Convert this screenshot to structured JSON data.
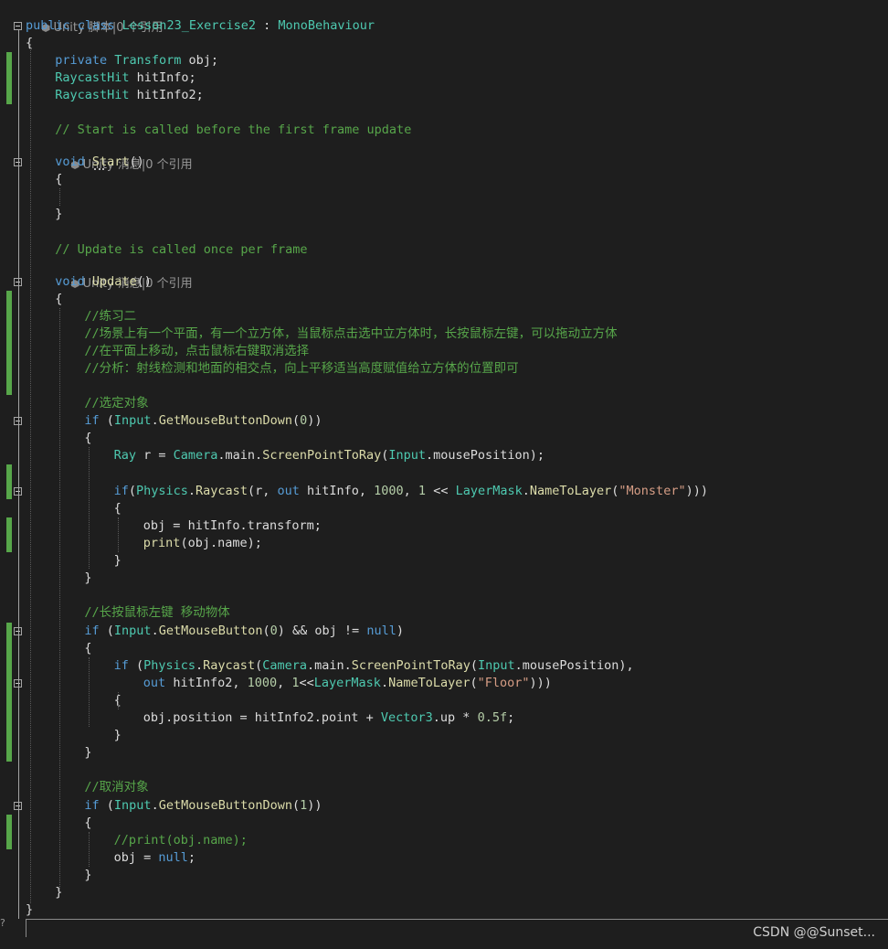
{
  "editor": {
    "codelens": {
      "class_lens": "Unity 脚本|0 个引用",
      "start_lens": "Unity 消息|0 个引用",
      "update_lens": "Unity 消息|0 个引用"
    },
    "lines": [
      [
        [
          "public class ",
          "kw"
        ],
        [
          "Lesson23_Exercise2",
          "ty"
        ],
        [
          " : ",
          "pl"
        ],
        [
          "MonoBehaviour",
          "ty"
        ]
      ],
      [
        [
          "{",
          "pl"
        ]
      ],
      [],
      [
        [
          "private ",
          "kw"
        ],
        [
          "Transform",
          "ty"
        ],
        [
          " obj;",
          "pl"
        ]
      ],
      [
        [
          "RaycastHit",
          "ty"
        ],
        [
          " hitInfo;",
          "pl"
        ]
      ],
      [
        [
          "RaycastHit",
          "ty"
        ],
        [
          " hitInfo2;",
          "pl"
        ]
      ],
      [],
      [
        [
          "// Start is called before the first frame update",
          "cm"
        ]
      ],
      [
        [
          "void ",
          "kw"
        ],
        [
          "Start",
          "me"
        ],
        [
          "()",
          "pl"
        ]
      ],
      [
        [
          "{",
          "pl"
        ]
      ],
      [],
      [
        [
          "}",
          "pl"
        ]
      ],
      [],
      [
        [
          "// Update is called once per frame",
          "cm"
        ]
      ],
      [
        [
          "void ",
          "kw"
        ],
        [
          "Update",
          "me"
        ],
        [
          "()",
          "pl"
        ]
      ],
      [
        [
          "{",
          "pl"
        ]
      ],
      [
        [
          "//练习二",
          "cm"
        ]
      ],
      [
        [
          "//场景上有一个平面，有一个立方体，当鼠标点击选中立方体时，长按鼠标左键，可以拖动立方体",
          "cm"
        ]
      ],
      [
        [
          "//在平面上移动，点击鼠标右键取消选择",
          "cm"
        ]
      ],
      [
        [
          "//分析：射线检测和地面的相交点，向上平移适当高度赋值给立方体的位置即可",
          "cm"
        ]
      ],
      [],
      [
        [
          "//选定对象",
          "cm"
        ]
      ],
      [
        [
          "if",
          "kw"
        ],
        [
          " (",
          "pl"
        ],
        [
          "Input",
          "ty"
        ],
        [
          ".",
          "pl"
        ],
        [
          "GetMouseButtonDown",
          "me"
        ],
        [
          "(",
          "pl"
        ],
        [
          "0",
          "nu"
        ],
        [
          "))",
          "pl"
        ]
      ],
      [
        [
          "{",
          "pl"
        ]
      ],
      [
        [
          "Ray",
          "ty"
        ],
        [
          " r = ",
          "pl"
        ],
        [
          "Camera",
          "ty"
        ],
        [
          ".main.",
          "pl"
        ],
        [
          "ScreenPointToRay",
          "me"
        ],
        [
          "(",
          "pl"
        ],
        [
          "Input",
          "ty"
        ],
        [
          ".mousePosition);",
          "pl"
        ]
      ],
      [],
      [
        [
          "if",
          "kw"
        ],
        [
          "(",
          "pl"
        ],
        [
          "Physics",
          "ty"
        ],
        [
          ".",
          "pl"
        ],
        [
          "Raycast",
          "me"
        ],
        [
          "(r, ",
          "pl"
        ],
        [
          "out",
          "kw"
        ],
        [
          " hitInfo, ",
          "pl"
        ],
        [
          "1000",
          "nu"
        ],
        [
          ", ",
          "pl"
        ],
        [
          "1",
          "nu"
        ],
        [
          " << ",
          "pl"
        ],
        [
          "LayerMask",
          "ty"
        ],
        [
          ".",
          "pl"
        ],
        [
          "NameToLayer",
          "me"
        ],
        [
          "(",
          "pl"
        ],
        [
          "\"Monster\"",
          "st"
        ],
        [
          ")))",
          "pl"
        ]
      ],
      [
        [
          "{",
          "pl"
        ]
      ],
      [
        [
          "obj = hitInfo.transform;",
          "pl"
        ]
      ],
      [
        [
          "print",
          "me"
        ],
        [
          "(obj.name);",
          "pl"
        ]
      ],
      [
        [
          "}",
          "pl"
        ]
      ],
      [
        [
          "}",
          "pl"
        ]
      ],
      [],
      [
        [
          "//长按鼠标左键 移动物体",
          "cm"
        ]
      ],
      [
        [
          "if",
          "kw"
        ],
        [
          " (",
          "pl"
        ],
        [
          "Input",
          "ty"
        ],
        [
          ".",
          "pl"
        ],
        [
          "GetMouseButton",
          "me"
        ],
        [
          "(",
          "pl"
        ],
        [
          "0",
          "nu"
        ],
        [
          ") && obj != ",
          "pl"
        ],
        [
          "null",
          "kw"
        ],
        [
          ")",
          "pl"
        ]
      ],
      [
        [
          "{",
          "pl"
        ]
      ],
      [
        [
          "if",
          "kw"
        ],
        [
          " (",
          "pl"
        ],
        [
          "Physics",
          "ty"
        ],
        [
          ".",
          "pl"
        ],
        [
          "Raycast",
          "me"
        ],
        [
          "(",
          "pl"
        ],
        [
          "Camera",
          "ty"
        ],
        [
          ".main.",
          "pl"
        ],
        [
          "ScreenPointToRay",
          "me"
        ],
        [
          "(",
          "pl"
        ],
        [
          "Input",
          "ty"
        ],
        [
          ".mousePosition),",
          "pl"
        ]
      ],
      [
        [
          "out",
          "kw"
        ],
        [
          " hitInfo2, ",
          "pl"
        ],
        [
          "1000",
          "nu"
        ],
        [
          ", ",
          "pl"
        ],
        [
          "1",
          "nu"
        ],
        [
          "<<",
          "pl"
        ],
        [
          "LayerMask",
          "ty"
        ],
        [
          ".",
          "pl"
        ],
        [
          "NameToLayer",
          "me"
        ],
        [
          "(",
          "pl"
        ],
        [
          "\"Floor\"",
          "st"
        ],
        [
          ")))",
          "pl"
        ]
      ],
      [
        [
          "{",
          "pl"
        ]
      ],
      [
        [
          "obj.position = hitInfo2.point + ",
          "pl"
        ],
        [
          "Vector3",
          "ty"
        ],
        [
          ".up * ",
          "pl"
        ],
        [
          "0.5f",
          "nu"
        ],
        [
          ";",
          "pl"
        ]
      ],
      [
        [
          "}",
          "pl"
        ]
      ],
      [
        [
          "}",
          "pl"
        ]
      ],
      [],
      [
        [
          "//取消对象",
          "cm"
        ]
      ],
      [
        [
          "if",
          "kw"
        ],
        [
          " (",
          "pl"
        ],
        [
          "Input",
          "ty"
        ],
        [
          ".",
          "pl"
        ],
        [
          "GetMouseButtonDown",
          "me"
        ],
        [
          "(",
          "pl"
        ],
        [
          "1",
          "nu"
        ],
        [
          "))",
          "pl"
        ]
      ],
      [
        [
          "{",
          "pl"
        ]
      ],
      [
        [
          "//print(obj.name);",
          "cm"
        ]
      ],
      [
        [
          "obj = ",
          "pl"
        ],
        [
          "null",
          "kw"
        ],
        [
          ";",
          "pl"
        ]
      ],
      [
        [
          "}",
          "pl"
        ]
      ],
      [
        [
          "}",
          "pl"
        ]
      ],
      [
        [
          "}",
          "pl"
        ]
      ]
    ]
  },
  "bottom_mark": "?",
  "watermark": "CSDN @@Sunset..."
}
